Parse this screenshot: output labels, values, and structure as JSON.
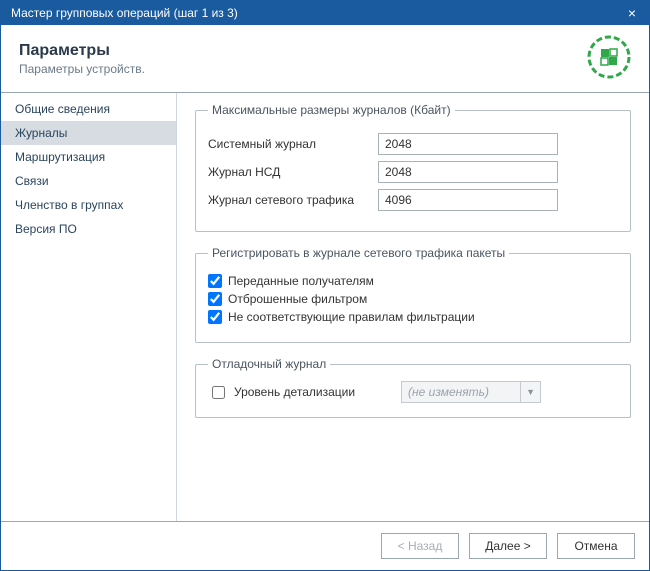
{
  "window": {
    "title": "Мастер групповых операций (шаг 1 из 3)"
  },
  "header": {
    "title": "Параметры",
    "subtitle": "Параметры устройств."
  },
  "sidebar": {
    "items": [
      {
        "label": "Общие сведения",
        "selected": false
      },
      {
        "label": "Журналы",
        "selected": true
      },
      {
        "label": "Маршрутизация",
        "selected": false
      },
      {
        "label": "Связи",
        "selected": false
      },
      {
        "label": "Членство в группах",
        "selected": false
      },
      {
        "label": "Версия ПО",
        "selected": false
      }
    ]
  },
  "content": {
    "max_sizes": {
      "legend": "Максимальные размеры журналов (Кбайт)",
      "system_log_label": "Системный журнал",
      "system_log_value": "2048",
      "nsd_log_label": "Журнал НСД",
      "nsd_log_value": "2048",
      "traffic_log_label": "Журнал сетевого трафика",
      "traffic_log_value": "4096"
    },
    "register": {
      "legend": "Регистрировать в журнале сетевого трафика пакеты",
      "delivered_label": "Переданные получателям",
      "delivered_checked": true,
      "dropped_label": "Отброшенные фильтром",
      "dropped_checked": true,
      "nomatch_label": "Не соответствующие правилам фильтрации",
      "nomatch_checked": true
    },
    "debug": {
      "legend": "Отладочный журнал",
      "level_label": "Уровень детализации",
      "level_checked": false,
      "level_value": "(не изменять)"
    }
  },
  "footer": {
    "back": "< Назад",
    "next": "Далее >",
    "cancel": "Отмена"
  }
}
